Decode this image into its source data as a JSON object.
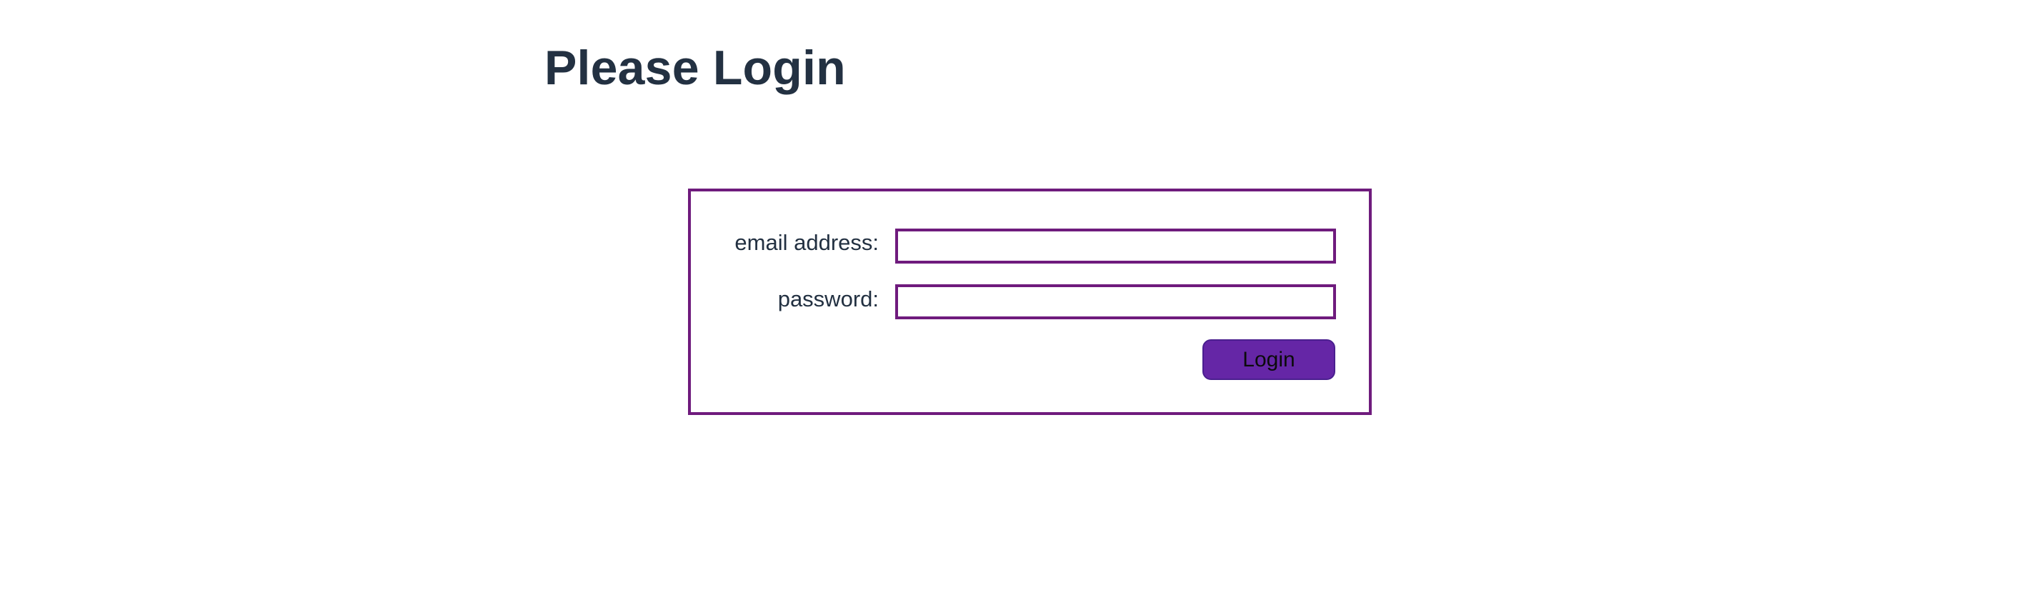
{
  "page": {
    "title": "Please Login"
  },
  "login_form": {
    "email_label": "email address:",
    "email_value": "",
    "password_label": "password:",
    "password_value": "",
    "login_button_label": "Login"
  },
  "colors": {
    "accent": "#6f1b7d",
    "button": "#6526a6",
    "title_text": "#233142",
    "body_text": "#223041"
  }
}
